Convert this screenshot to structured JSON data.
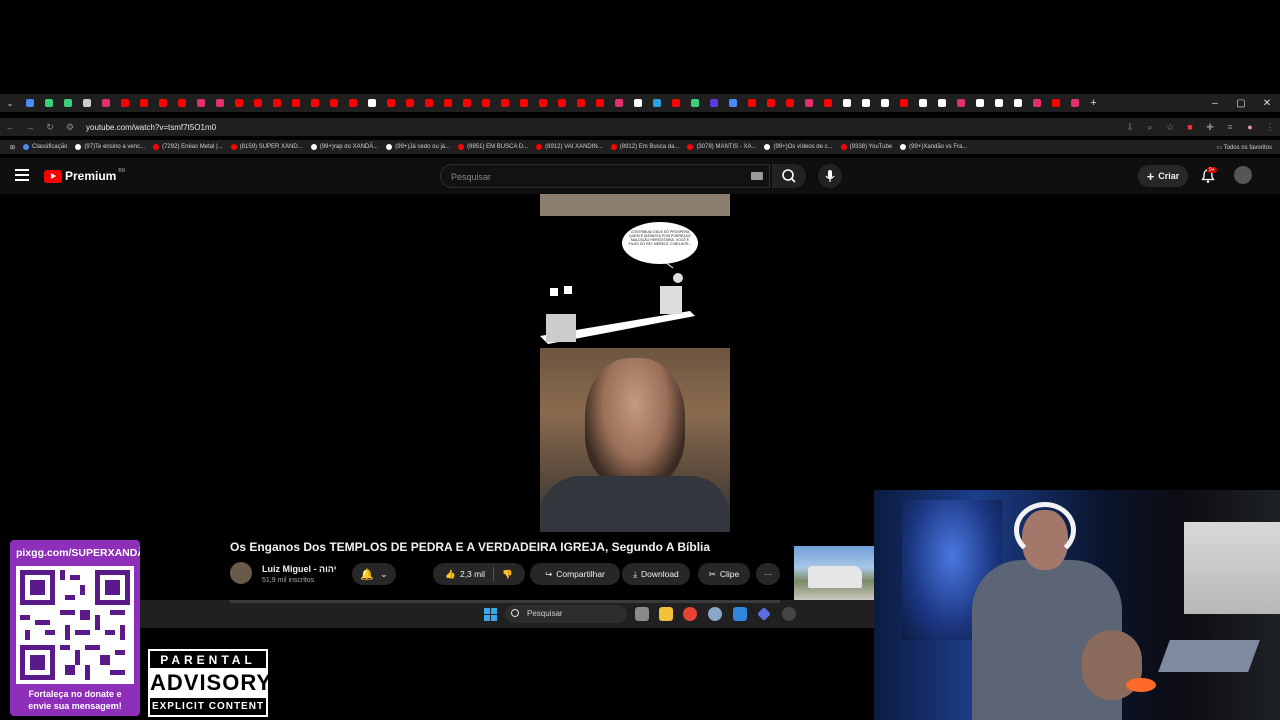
{
  "browser": {
    "url": "youtube.com/watch?v=tsmf7t5O1m0",
    "bookmarks": [
      {
        "label": "Classificação",
        "color": "#4c8bf5"
      },
      {
        "label": "(97)Te ensino a venc...",
        "color": "#ffffff"
      },
      {
        "label": "(7292) Enéas Metal |...",
        "color": "#ff0000"
      },
      {
        "label": "(8159) SUPER XAND...",
        "color": "#ff0000"
      },
      {
        "label": "(99+)rap do XANDÃ...",
        "color": "#ffffff"
      },
      {
        "label": "(99+)Já cedo ou já...",
        "color": "#ffffff"
      },
      {
        "label": "(8851) EM BUSCA D...",
        "color": "#ff0000"
      },
      {
        "label": "(8912) VAI XANDIN...",
        "color": "#ff0000"
      },
      {
        "label": "(8912) Em Busca da...",
        "color": "#ff0000"
      },
      {
        "label": "(3078) MANTIS - XA...",
        "color": "#ff0000"
      },
      {
        "label": "(99+)Os vídeos de c...",
        "color": "#ffffff"
      },
      {
        "label": "(9338) YouTube",
        "color": "#ff0000"
      },
      {
        "label": "(99+)Xandão vs Fra...",
        "color": "#ffffff"
      }
    ],
    "all_bookmarks_label": "Todos os favoritos",
    "window_controls": [
      "–",
      "▢",
      "✕"
    ]
  },
  "youtube": {
    "logo_text": "Premium",
    "country_code": "BR",
    "search_placeholder": "Pesquisar",
    "create_label": "Criar",
    "notification_badge": "9+"
  },
  "video": {
    "cartoon_text": "CONTRIBUA! DEUS SÓ PROSPERA QUEM É DIZIMISTA POIS POBREZA É MALDIÇÃO HEREDITÁRIA. VOCÊ É FILHO DO REI, MERECE O MELHOR...",
    "title": "Os Enganos Dos TEMPLOS DE PEDRA E A VERDADEIRA IGREJA, Segundo A Bíblia",
    "channel_name": "Luiz Miguel - יהוה",
    "channel_subs": "51,9 mil inscritos",
    "likes": "2,3 mil",
    "share_label": "Compartilhar",
    "download_label": "Download",
    "clip_label": "Clipe",
    "more_label": "···"
  },
  "taskbar": {
    "search_placeholder": "Pesquisar"
  },
  "overlay": {
    "qr_url": "pixgg.com/SUPERXANDÃO",
    "qr_message_line1": "Fortaleça no donate e",
    "qr_message_line2": "envie sua mensagem!",
    "advisory_top": "PARENTAL",
    "advisory_mid": "ADVISORY",
    "advisory_bottom": "EXPLICIT CONTENT"
  }
}
